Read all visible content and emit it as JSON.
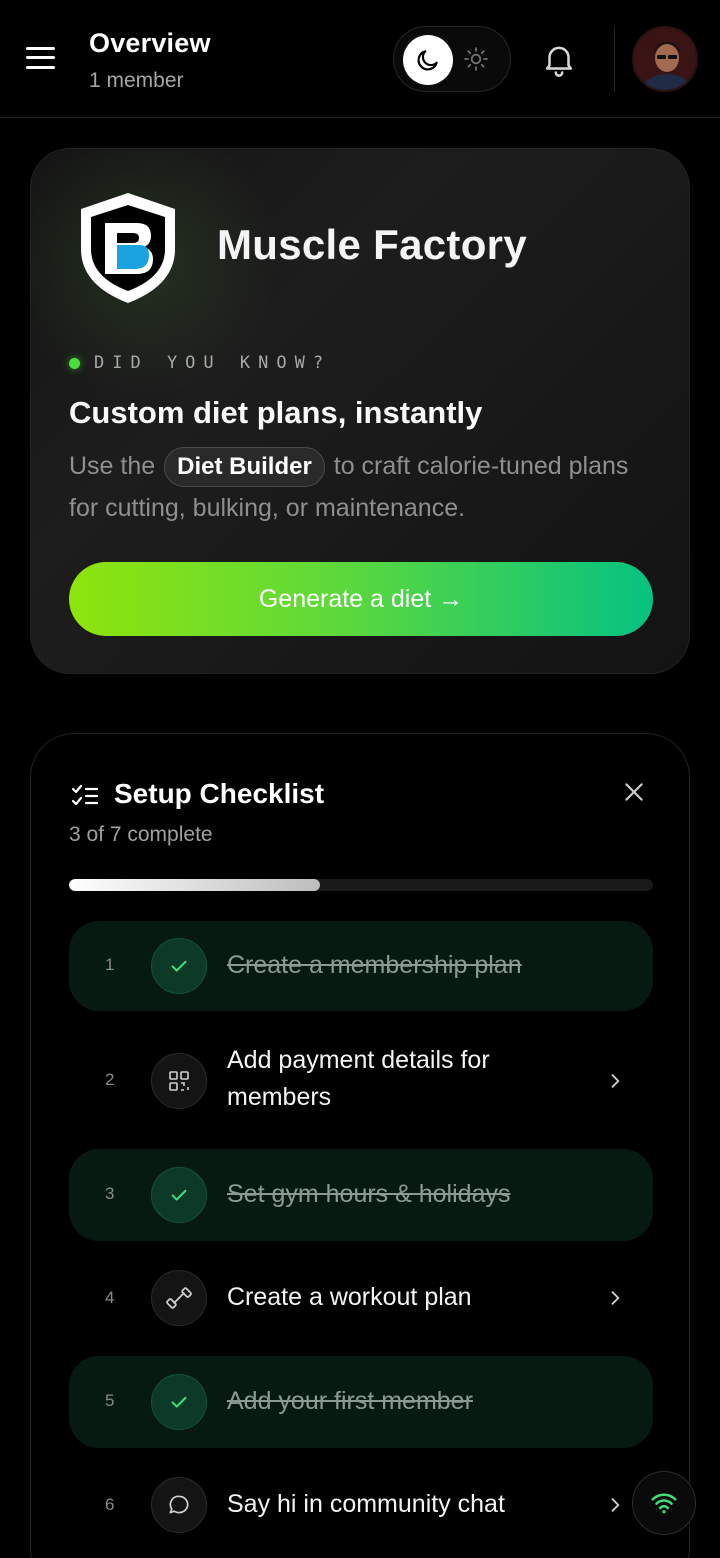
{
  "header": {
    "title": "Overview",
    "subtitle": "1 member"
  },
  "hero": {
    "brand_name": "Muscle Factory",
    "kicker": "DID YOU KNOW?",
    "heading": "Custom diet plans, instantly",
    "body_before": "Use the",
    "body_pill": "Diet Builder",
    "body_after": "to craft calorie-tuned plans for cutting, bulking, or maintenance.",
    "cta_label": "Generate a diet →",
    "cta_gradient": [
      "#8fe40c",
      "#06c282"
    ]
  },
  "checklist": {
    "title": "Setup Checklist",
    "progress_text": "3 of 7 complete",
    "progress_fraction": 0.43,
    "items": [
      {
        "num": "1",
        "label": "Create a membership plan",
        "done": true,
        "icon": "check-icon"
      },
      {
        "num": "2",
        "label": "Add payment details for members",
        "done": false,
        "icon": "qr-code-icon"
      },
      {
        "num": "3",
        "label": "Set gym hours & holidays",
        "done": true,
        "icon": "check-icon"
      },
      {
        "num": "4",
        "label": "Create a workout plan",
        "done": false,
        "icon": "dumbbell-icon"
      },
      {
        "num": "5",
        "label": "Add your first member",
        "done": true,
        "icon": "check-icon"
      },
      {
        "num": "6",
        "label": "Say hi in community chat",
        "done": false,
        "icon": "chat-bubble-icon"
      }
    ]
  },
  "colors": {
    "accent_green": "#4ade3a",
    "done_bg": "#061a12",
    "brand_blue": "#1aa3e0"
  }
}
